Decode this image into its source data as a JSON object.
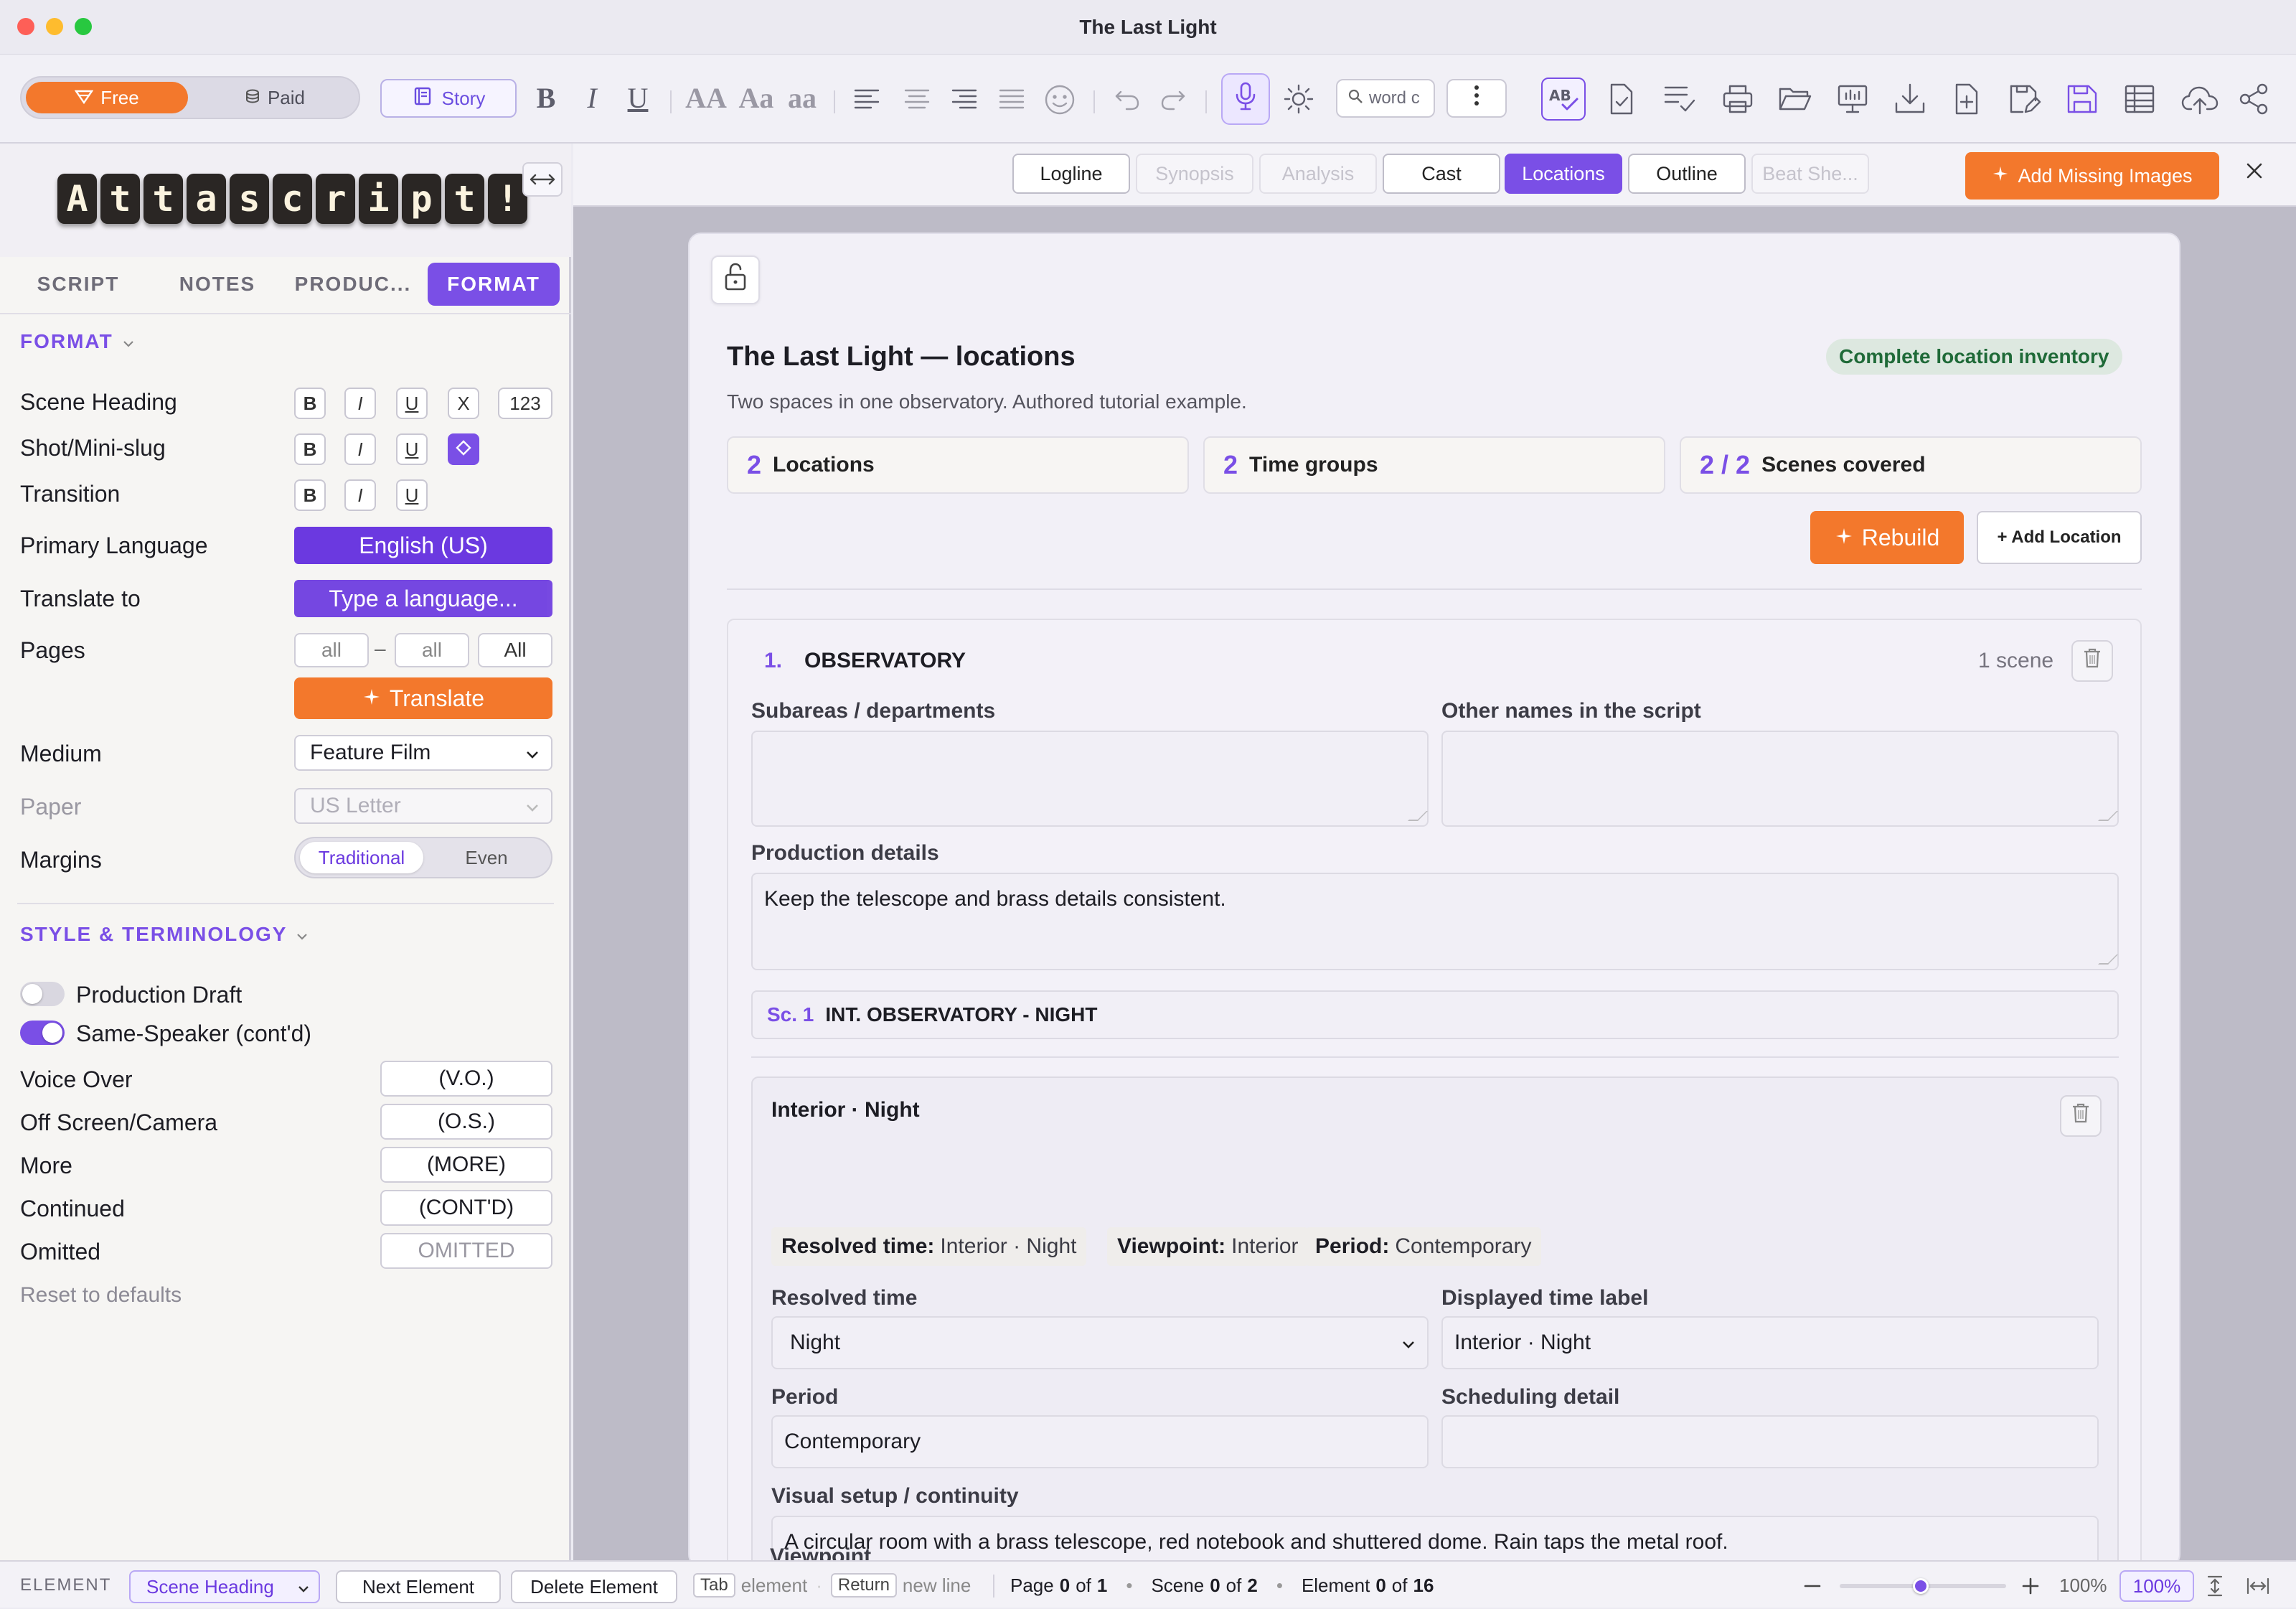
{
  "window": {
    "title": "The Last Light"
  },
  "toolbar": {
    "plan_free": "Free",
    "plan_paid": "Paid",
    "story_label": "Story",
    "bold": "B",
    "italic": "I",
    "underline": "U",
    "case_upper": "AA",
    "case_title": "Aa",
    "case_lower": "aa",
    "search_placeholder": "word c"
  },
  "sidebar": {
    "logo_letters": [
      "A",
      "t",
      "t",
      "a",
      "s",
      "c",
      "r",
      "i",
      "p",
      "t",
      "!"
    ],
    "tabs": {
      "script": "SCRIPT",
      "notes": "NOTES",
      "production": "PRODUC...",
      "format": "FORMAT"
    },
    "format_section": "FORMAT",
    "rows": {
      "scene_heading": "Scene Heading",
      "shot": "Shot/Mini-slug",
      "transition": "Transition",
      "primary_language": "Primary Language",
      "translate_to": "Translate to",
      "pages": "Pages",
      "medium": "Medium",
      "paper": "Paper",
      "margins": "Margins"
    },
    "fmt_buttons": {
      "bold": "B",
      "italic": "I",
      "underline": "U",
      "clear": "X",
      "numbers": "123"
    },
    "primary_language_value": "English (US)",
    "translate_placeholder": "Type a language...",
    "pages_from": "all",
    "pages_dash": "–",
    "pages_to": "all",
    "pages_all_button": "All",
    "translate_button": "Translate",
    "medium_value": "Feature Film",
    "paper_value": "US Letter",
    "margins_options": [
      "Traditional",
      "Even"
    ],
    "style_section": "STYLE & TERMINOLOGY",
    "toggles": {
      "production_draft": "Production Draft",
      "same_speaker": "Same-Speaker (cont'd)"
    },
    "terms": [
      {
        "label": "Voice Over",
        "value": "(V.O.)"
      },
      {
        "label": "Off Screen/Camera",
        "value": "(O.S.)"
      },
      {
        "label": "More",
        "value": "(MORE)"
      },
      {
        "label": "Continued",
        "value": "(CONT'D)"
      },
      {
        "label": "Omitted",
        "value": "OMITTED"
      }
    ],
    "reset": "Reset to defaults"
  },
  "doc_tabs": [
    "Logline",
    "Synopsis",
    "Analysis",
    "Cast",
    "Locations",
    "Outline",
    "Beat She..."
  ],
  "add_missing_images": "Add Missing Images",
  "locations": {
    "title": "The Last Light — locations",
    "subtitle": "Two spaces in one observatory. Authored tutorial example.",
    "badge": "Complete location inventory",
    "stats": [
      {
        "num": "2",
        "label": "Locations"
      },
      {
        "num": "2",
        "label": "Time groups"
      },
      {
        "num": "2 / 2",
        "label": "Scenes covered"
      }
    ],
    "rebuild": "Rebuild",
    "add_location": "+ Add Location",
    "location": {
      "index": "1.",
      "name": "OBSERVATORY",
      "scene_count": "1 scene",
      "subareas_label": "Subareas / departments",
      "other_names_label": "Other names in the script",
      "production_details_label": "Production details",
      "production_details_value": "Keep the telescope and brass details consistent.",
      "scene_ref": "Sc. 1",
      "scene_heading": "INT. OBSERVATORY - NIGHT"
    },
    "time_group": {
      "title": "Interior · Night",
      "chips": [
        {
          "key": "Resolved time:",
          "value": "Interior · Night"
        },
        {
          "key": "Viewpoint:",
          "value": "Interior"
        },
        {
          "key": "Period:",
          "value": "Contemporary"
        }
      ],
      "resolved_time_label": "Resolved time",
      "resolved_time_value": "Night",
      "displayed_label": "Displayed time label",
      "displayed_value": "Interior · Night",
      "period_label": "Period",
      "period_value": "Contemporary",
      "scheduling_label": "Scheduling detail",
      "visual_label": "Visual setup / continuity",
      "visual_value": "A circular room with a brass telescope, red notebook and shuttered dome. Rain taps the metal roof.",
      "viewpoint_label": "Viewpoint"
    }
  },
  "statusbar": {
    "element_label": "ELEMENT",
    "element_value": "Scene Heading",
    "next_element": "Next Element",
    "delete_element": "Delete Element",
    "tab_key": "Tab",
    "tab_hint": "element",
    "return_key": "Return",
    "return_hint": "new line",
    "page_word": "Page",
    "page_cur": "0",
    "page_of": "of",
    "page_total": "1",
    "scene_word": "Scene",
    "scene_cur": "0",
    "scene_of": "of",
    "scene_total": "2",
    "element_word": "Element",
    "element_cur": "0",
    "element_of": "of",
    "element_total": "16",
    "zoom_text": "100%",
    "zoom_badge": "100%",
    "zoom_level": 0.5
  },
  "colors": {
    "accent": "#7a4fe6",
    "orange": "#f3782c"
  }
}
